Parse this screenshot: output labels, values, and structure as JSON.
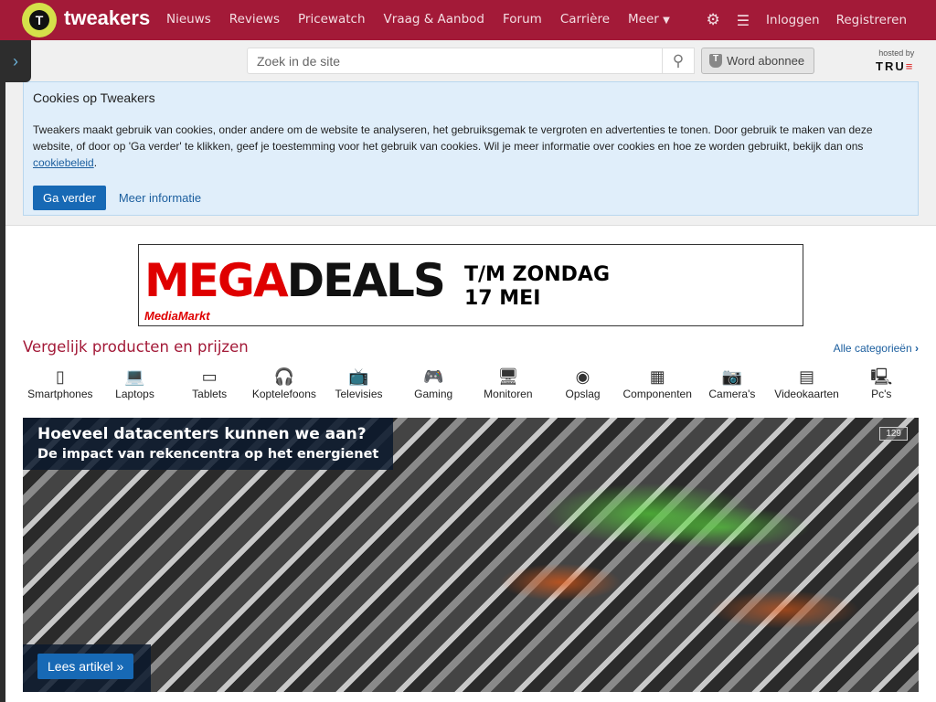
{
  "header": {
    "logo_text": "tweakers",
    "nav": [
      "Nieuws",
      "Reviews",
      "Pricewatch",
      "Vraag & Aanbod",
      "Forum",
      "Carrière",
      "Meer"
    ],
    "login": "Inloggen",
    "register": "Registreren"
  },
  "subbar": {
    "search_placeholder": "Zoek in de site",
    "subscribe": "Word abonnee",
    "hosted_by": "hosted by",
    "host_logo": "TRUE"
  },
  "cookie": {
    "title": "Cookies op Tweakers",
    "text": "Tweakers maakt gebruik van cookies, onder andere om de website te analyseren, het gebruiksgemak te vergroten en advertenties te tonen. Door gebruik te maken van deze website, of door op 'Ga verder' te klikken, geef je toestemming voor het gebruik van cookies. Wil je meer informatie over cookies en hoe ze worden gebruikt, bekijk dan ons",
    "link": "cookiebeleid",
    "accept": "Ga verder",
    "more": "Meer informatie"
  },
  "ad": {
    "mega": "MEGA",
    "deals": "DEALS",
    "line1": "T/M ZONDAG",
    "line2": "17 MEI",
    "brand": "MediaMarkt"
  },
  "compare": {
    "title": "Vergelijk producten en prijzen",
    "all": "Alle categorieën",
    "categories": [
      {
        "label": "Smartphones",
        "icon": "▯"
      },
      {
        "label": "Laptops",
        "icon": "💻"
      },
      {
        "label": "Tablets",
        "icon": "▭"
      },
      {
        "label": "Koptelefoons",
        "icon": "🎧"
      },
      {
        "label": "Televisies",
        "icon": "📺"
      },
      {
        "label": "Gaming",
        "icon": "🎮"
      },
      {
        "label": "Monitoren",
        "icon": "🖥"
      },
      {
        "label": "Opslag",
        "icon": "◉"
      },
      {
        "label": "Componenten",
        "icon": "▦"
      },
      {
        "label": "Camera's",
        "icon": "📷"
      },
      {
        "label": "Videokaarten",
        "icon": "▤"
      },
      {
        "label": "Pc's",
        "icon": "🖳"
      }
    ]
  },
  "hero": {
    "title": "Hoeveel datacenters kunnen we aan?",
    "subtitle": "De impact van rekencentra op het energienet",
    "comments": "129",
    "read": "Lees artikel »"
  }
}
